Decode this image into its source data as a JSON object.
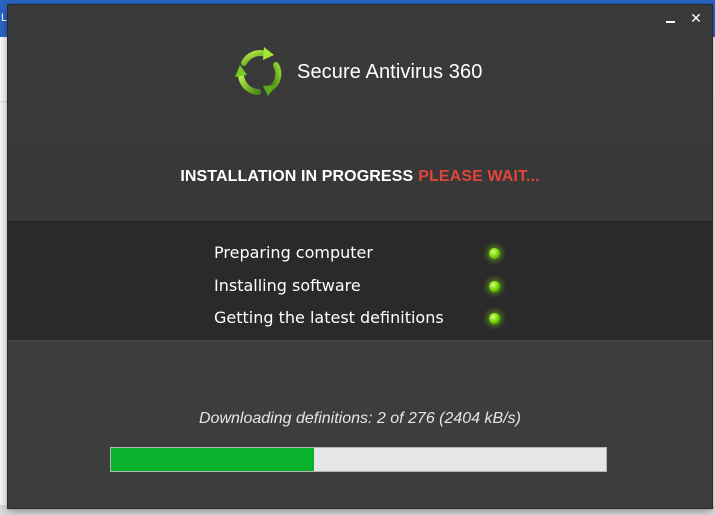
{
  "background_app": {
    "title_glyph": "L"
  },
  "installer": {
    "window_controls": {
      "minimize_icon": "minimize-icon",
      "close_icon": "close-icon",
      "close_glyph": "✕"
    },
    "brand": {
      "logo_icon": "recycle-arrows-icon",
      "name": "Secure Antivirus 360"
    },
    "status": {
      "main": "INSTALLATION IN PROGRESS",
      "wait": "PLEASE WAIT..."
    },
    "steps": [
      {
        "label": "Preparing computer",
        "status_icon": "green-light-icon"
      },
      {
        "label": "Installing software",
        "status_icon": "green-light-icon"
      },
      {
        "label": "Getting the latest definitions",
        "status_icon": "green-light-icon"
      }
    ],
    "download": {
      "text": "Downloading definitions: 2 of 276 (2404 kB/s)",
      "progress": 0.41
    },
    "colors": {
      "window_bg": "#3d3d3d",
      "panel_bg": "#2a2a2a",
      "accent_red": "#e0453a",
      "progress_green": "#09b22d",
      "status_light": "#7dd80d"
    }
  }
}
